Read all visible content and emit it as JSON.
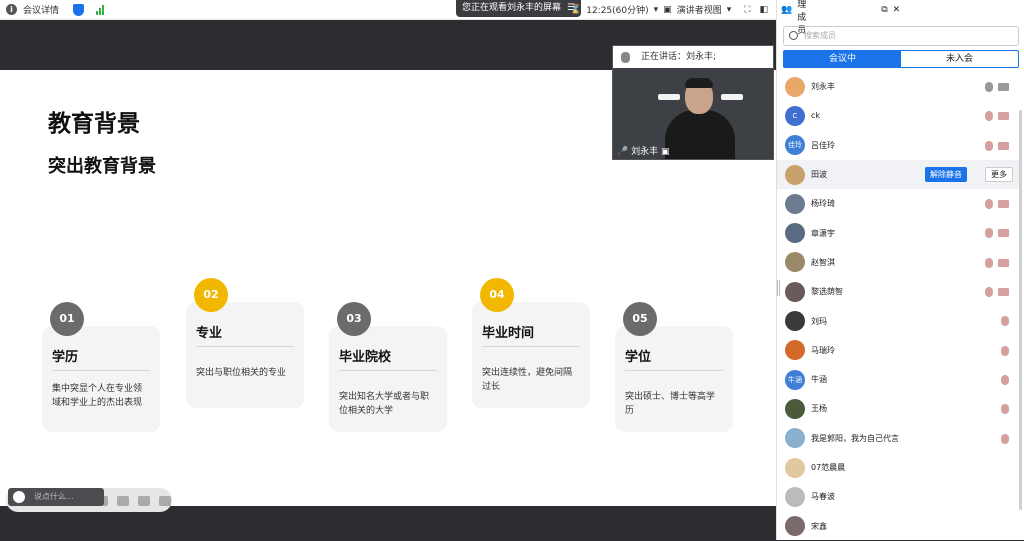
{
  "topbar": {
    "meeting_details": "会议详情",
    "viewing_text": "您正在观看刘永丰的屏幕",
    "time": "12:25(60分钟)",
    "view_mode": "演讲者视图"
  },
  "slide": {
    "title": "教育背景",
    "subtitle": "突出教育背景",
    "cards": [
      {
        "num": "01",
        "title": "学历",
        "desc": "集中突显个人在专业领域和学业上的杰出表现"
      },
      {
        "num": "02",
        "title": "专业",
        "desc": "突出与职位相关的专业"
      },
      {
        "num": "03",
        "title": "毕业院校",
        "desc": "突出知名大学或者与职位相关的大学"
      },
      {
        "num": "04",
        "title": "毕业时间",
        "desc": "突出连续性，避免间隔过长"
      },
      {
        "num": "05",
        "title": "学位",
        "desc": "突出硕士、博士等高学历"
      }
    ]
  },
  "annotation": {
    "placeholder": "说点什么..."
  },
  "video": {
    "speaking_label": "正在讲话：刘永丰;",
    "name": "刘永丰"
  },
  "panel": {
    "title": "管理成员",
    "search_placeholder": "搜索成员",
    "tab_in_meeting": "会议中",
    "tab_not_joined": "未入会",
    "unmute_label": "解除静音",
    "more_label": "更多",
    "members": [
      {
        "name": "刘永丰",
        "avatar": "",
        "color": "#e7a86a"
      },
      {
        "name": "ck",
        "avatar": "C",
        "color": "#3f6fd1"
      },
      {
        "name": "吕佳玲",
        "avatar": "佳玲",
        "color": "#3f7fd6"
      },
      {
        "name": "田波",
        "avatar": "",
        "color": "#c9a26b"
      },
      {
        "name": "杨玲琦",
        "avatar": "",
        "color": "#6b7c90"
      },
      {
        "name": "章潇宇",
        "avatar": "",
        "color": "#5a6a80"
      },
      {
        "name": "赵智淇",
        "avatar": "",
        "color": "#9a8a6a"
      },
      {
        "name": "黎选荫智",
        "avatar": "",
        "color": "#6a5a5a"
      },
      {
        "name": "刘玛",
        "avatar": "",
        "color": "#3a3a3a"
      },
      {
        "name": "马瑞玲",
        "avatar": "",
        "color": "#d46a2a"
      },
      {
        "name": "牛涵",
        "avatar": "牛涵",
        "color": "#3f7fd6"
      },
      {
        "name": "王杨",
        "avatar": "",
        "color": "#4a5a3a"
      },
      {
        "name": "我是郭阳，我为自己代言",
        "avatar": "",
        "color": "#8ab0d0"
      },
      {
        "name": "07范晨晨",
        "avatar": "",
        "color": "#e0c8a0"
      },
      {
        "name": "马春波",
        "avatar": "",
        "color": "#bbbbbb"
      },
      {
        "name": "宋鑫",
        "avatar": "",
        "color": "#7a6a6a"
      }
    ]
  }
}
